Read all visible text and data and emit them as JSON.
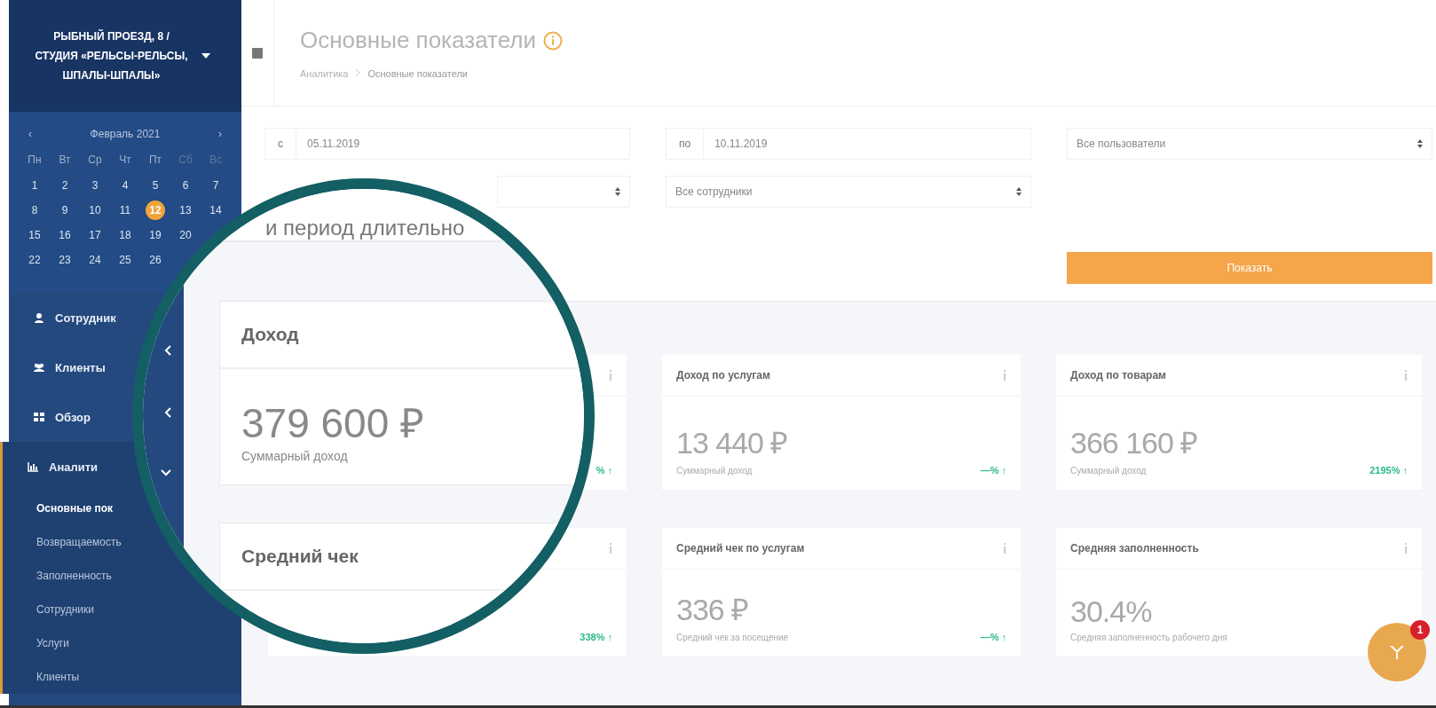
{
  "sidebar": {
    "location": "РЫБНЫЙ ПРОЕЗД, 8 / СТУДИЯ «РЕЛЬСЫ-РЕЛЬСЫ, ШПАЛЫ-ШПАЛЫ»",
    "calendar": {
      "prev": "‹",
      "month": "Февраль 2021",
      "next": "›",
      "weekdays": [
        {
          "label": "Пн",
          "weekend": false
        },
        {
          "label": "Вт",
          "weekend": false
        },
        {
          "label": "Ср",
          "weekend": false
        },
        {
          "label": "Чт",
          "weekend": false
        },
        {
          "label": "Пт",
          "weekend": false
        },
        {
          "label": "Сб",
          "weekend": true
        },
        {
          "label": "Вс",
          "weekend": true
        }
      ],
      "weeks": [
        {
          "days": [
            {
              "label": "1",
              "selected": false
            },
            {
              "label": "2",
              "selected": false
            },
            {
              "label": "3",
              "selected": false
            },
            {
              "label": "4",
              "selected": false
            },
            {
              "label": "5",
              "selected": false
            },
            {
              "label": "6",
              "selected": false
            },
            {
              "label": "7",
              "selected": false
            }
          ]
        },
        {
          "days": [
            {
              "label": "8",
              "selected": false
            },
            {
              "label": "9",
              "selected": false
            },
            {
              "label": "10",
              "selected": false
            },
            {
              "label": "11",
              "selected": false
            },
            {
              "label": "12",
              "selected": true
            },
            {
              "label": "13",
              "selected": false
            },
            {
              "label": "14",
              "selected": false
            }
          ]
        },
        {
          "days": [
            {
              "label": "15",
              "selected": false
            },
            {
              "label": "16",
              "selected": false
            },
            {
              "label": "17",
              "selected": false
            },
            {
              "label": "18",
              "selected": false
            },
            {
              "label": "19",
              "selected": false
            },
            {
              "label": "20",
              "selected": false
            }
          ]
        },
        {
          "days": [
            {
              "label": "22",
              "selected": false
            },
            {
              "label": "23",
              "selected": false
            },
            {
              "label": "24",
              "selected": false
            },
            {
              "label": "25",
              "selected": false
            },
            {
              "label": "26",
              "selected": false
            }
          ]
        }
      ]
    },
    "menu": [
      {
        "label": "Сотрудник",
        "kind": "link"
      },
      {
        "label": "Клиенты",
        "kind": "group",
        "expanded": false
      },
      {
        "label": "Обзор",
        "kind": "group",
        "expanded": false
      },
      {
        "label": "Аналити",
        "kind": "group",
        "expanded": true,
        "children": [
          {
            "label": "Основные пок",
            "selected": true
          },
          {
            "label": "Возвращаемость",
            "selected": false
          },
          {
            "label": "Заполненность",
            "selected": false
          },
          {
            "label": "Сотрудники",
            "selected": false
          },
          {
            "label": "Услуги",
            "selected": false
          },
          {
            "label": "Клиенты",
            "selected": false
          }
        ]
      }
    ]
  },
  "header": {
    "title": "Основные показатели",
    "breadcrumb": [
      "Аналитика",
      "Основные показатели"
    ]
  },
  "filters": {
    "from_label": "с",
    "from": "05.11.2019",
    "to_label": "по",
    "to": "10.11.2019",
    "users": "Все пользователи",
    "employees": "Все сотрудники",
    "button": "Показать"
  },
  "cards": [
    {
      "delta": "% ↑"
    },
    {
      "title": "Доход по услугам",
      "value": "13 440 ₽",
      "caption": "Суммарный доход",
      "delta": "—% ↑"
    },
    {
      "title": "Доход по товарам",
      "value": "366 160 ₽",
      "caption": "Суммарный доход",
      "delta": "2195% ↑"
    },
    {
      "delta": "338% ↑"
    },
    {
      "title": "Средний чек по услугам",
      "value": "336 ₽",
      "caption": "Средний чек за посещение",
      "delta": "—% ↑"
    },
    {
      "title": "Средняя заполненность",
      "value": "30.4%",
      "caption": "Средняя заполненность рабочего дня"
    }
  ],
  "magnifier": {
    "text": "и период длительно",
    "cards": [
      {
        "title": "Доход",
        "value": "379 600 ₽",
        "caption": "Суммарный доход"
      },
      {
        "title": "Средний чек"
      }
    ]
  },
  "chat": {
    "badge": "1"
  }
}
